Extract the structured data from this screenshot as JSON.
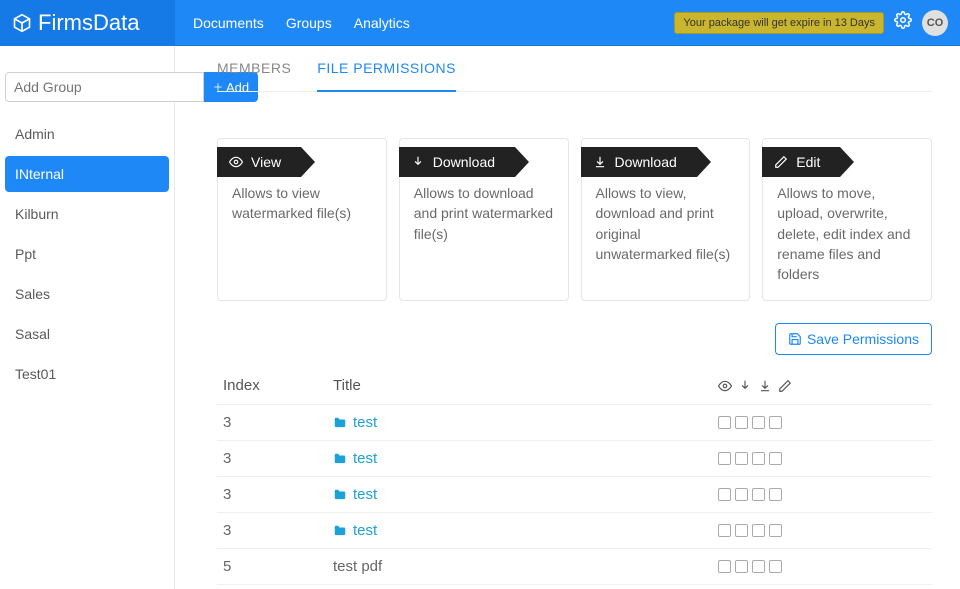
{
  "brand": "FirmsData",
  "nav": {
    "documents": "Documents",
    "groups": "Groups",
    "analytics": "Analytics"
  },
  "expire_msg": "Your package will get expire in 13 Days",
  "avatar_initials": "CO",
  "sidebar": {
    "add_placeholder": "Add Group",
    "add_btn": "Add",
    "groups": [
      {
        "name": "Admin",
        "active": false
      },
      {
        "name": "INternal",
        "active": true
      },
      {
        "name": "Kilburn",
        "active": false
      },
      {
        "name": "Ppt",
        "active": false
      },
      {
        "name": "Sales",
        "active": false
      },
      {
        "name": "Sasal",
        "active": false
      },
      {
        "name": "Test01",
        "active": false
      }
    ]
  },
  "tabs": {
    "members": "MEMBERS",
    "permissions": "FILE PERMISSIONS"
  },
  "perm_cards": [
    {
      "title": "View",
      "icon": "eye",
      "desc": "Allows to view watermarked file(s)"
    },
    {
      "title": "Download",
      "icon": "down",
      "desc": "Allows to download and print watermarked file(s)"
    },
    {
      "title": "Download",
      "icon": "down2",
      "desc": "Allows to view, download and print original unwatermarked file(s)"
    },
    {
      "title": "Edit",
      "icon": "pencil",
      "desc": "Allows to move, upload, overwrite, delete, edit index and rename files and folders"
    }
  ],
  "save_btn": "Save Permissions",
  "table": {
    "headers": {
      "index": "Index",
      "title": "Title"
    },
    "rows": [
      {
        "index": "3",
        "title": "test",
        "type": "folder"
      },
      {
        "index": "3",
        "title": "test",
        "type": "folder"
      },
      {
        "index": "3",
        "title": "test",
        "type": "folder"
      },
      {
        "index": "3",
        "title": "test",
        "type": "folder"
      },
      {
        "index": "5",
        "title": "test pdf",
        "type": "file"
      }
    ]
  }
}
